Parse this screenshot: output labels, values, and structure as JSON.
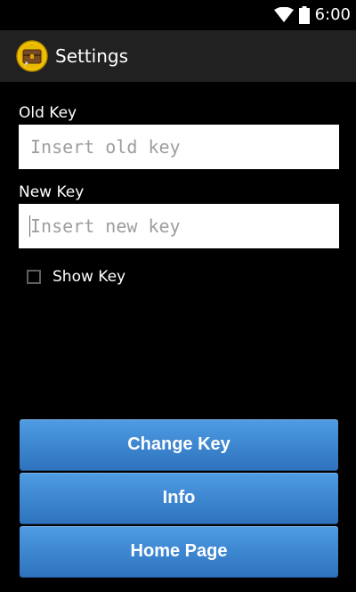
{
  "status_bar": {
    "time": "6:00",
    "icons": [
      "wifi-icon",
      "battery-icon"
    ]
  },
  "action_bar": {
    "title": "Settings",
    "icon": "treasure-chest-icon"
  },
  "form": {
    "old_key": {
      "label": "Old Key",
      "value": "",
      "placeholder": "Insert old key"
    },
    "new_key": {
      "label": "New Key",
      "value": "",
      "placeholder": "Insert new key"
    },
    "show_key": {
      "label": "Show Key",
      "checked": false
    }
  },
  "buttons": {
    "change_key": "Change Key",
    "info": "Info",
    "home_page": "Home Page"
  },
  "colors": {
    "background": "#000000",
    "action_bar": "#212121",
    "button_blue": "#3f89d3",
    "input_bg": "#ffffff",
    "placeholder": "#9e9e9e"
  }
}
